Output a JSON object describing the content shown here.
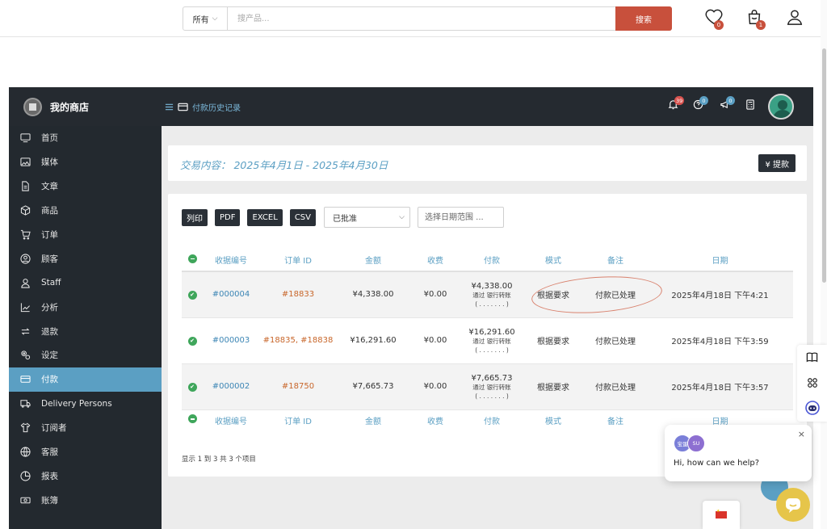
{
  "store_header": {
    "search_category": "所有",
    "search_placeholder": "搜产品...",
    "search_button": "搜索",
    "wishlist_count": "0",
    "cart_count": "1"
  },
  "app": {
    "brand_name": "我的商店",
    "breadcrumb": "付款历史记录",
    "notifications_count": "39",
    "help_count": "0",
    "announcements_count": "0"
  },
  "sidebar": {
    "items": [
      {
        "label": "首页",
        "icon": "monitor-icon"
      },
      {
        "label": "媒体",
        "icon": "image-icon"
      },
      {
        "label": "文章",
        "icon": "document-icon"
      },
      {
        "label": "商品",
        "icon": "box-icon"
      },
      {
        "label": "订单",
        "icon": "cart-icon"
      },
      {
        "label": "顾客",
        "icon": "user-circle-icon"
      },
      {
        "label": "Staff",
        "icon": "user-icon"
      },
      {
        "label": "分析",
        "icon": "chart-icon"
      },
      {
        "label": "退款",
        "icon": "refresh-icon"
      },
      {
        "label": "设定",
        "icon": "settings-icon"
      },
      {
        "label": "付款",
        "icon": "credit-card-icon"
      },
      {
        "label": "Delivery Persons",
        "icon": "truck-icon"
      },
      {
        "label": "订阅者",
        "icon": "shirt-icon"
      },
      {
        "label": "客服",
        "icon": "globe-icon"
      },
      {
        "label": "报表",
        "icon": "pie-icon"
      },
      {
        "label": "账簿",
        "icon": "cash-icon"
      }
    ],
    "active_index": 10
  },
  "period": {
    "title": "交易内容：  2025年4月1日 - 2025年4月30日",
    "withdraw_label": "¥  提款"
  },
  "toolbar": {
    "print": "列印",
    "pdf": "PDF",
    "excel": "EXCEL",
    "csv": "CSV",
    "status_selected": "已批准",
    "date_placeholder": "选择日期范围 ..."
  },
  "table": {
    "columns": [
      "收据编号",
      "订单 ID",
      "金额",
      "收费",
      "付款",
      "模式",
      "备注",
      "日期"
    ],
    "rows": [
      {
        "receipt": "#000004",
        "order": "#18833",
        "amount": "¥4,338.00",
        "fee": "¥0.00",
        "payment": "¥4,338.00",
        "via": "通过 银行转账",
        "dots": "( . . . . . . . )",
        "mode": "根据要求",
        "note": "付款已处理",
        "date": "2025年4月18日 下午4:21"
      },
      {
        "receipt": "#000003",
        "order": "#18835, #18838",
        "amount": "¥16,291.60",
        "fee": "¥0.00",
        "payment": "¥16,291.60",
        "via": "通过 银行转账",
        "dots": "( . . . . . . . )",
        "mode": "根据要求",
        "note": "付款已处理",
        "date": "2025年4月18日 下午3:59"
      },
      {
        "receipt": "#000002",
        "order": "#18750",
        "amount": "¥7,665.73",
        "fee": "¥0.00",
        "payment": "¥7,665.73",
        "via": "通过 银行转账",
        "dots": "( . . . . . . . )",
        "mode": "根据要求",
        "note": "付款已处理",
        "date": "2025年4月18日 下午3:57"
      }
    ],
    "info": "显示 1 到 3 共 3 个项目"
  },
  "chat": {
    "agent1": "宝蛋",
    "agent2": "SU",
    "message": "Hi, how can we help?",
    "close": "×"
  },
  "colors": {
    "accent": "#5b9fc3",
    "dark": "#23292f",
    "search_button": "#c8503c",
    "success": "#3fa65b",
    "order_link": "#c8662a"
  }
}
